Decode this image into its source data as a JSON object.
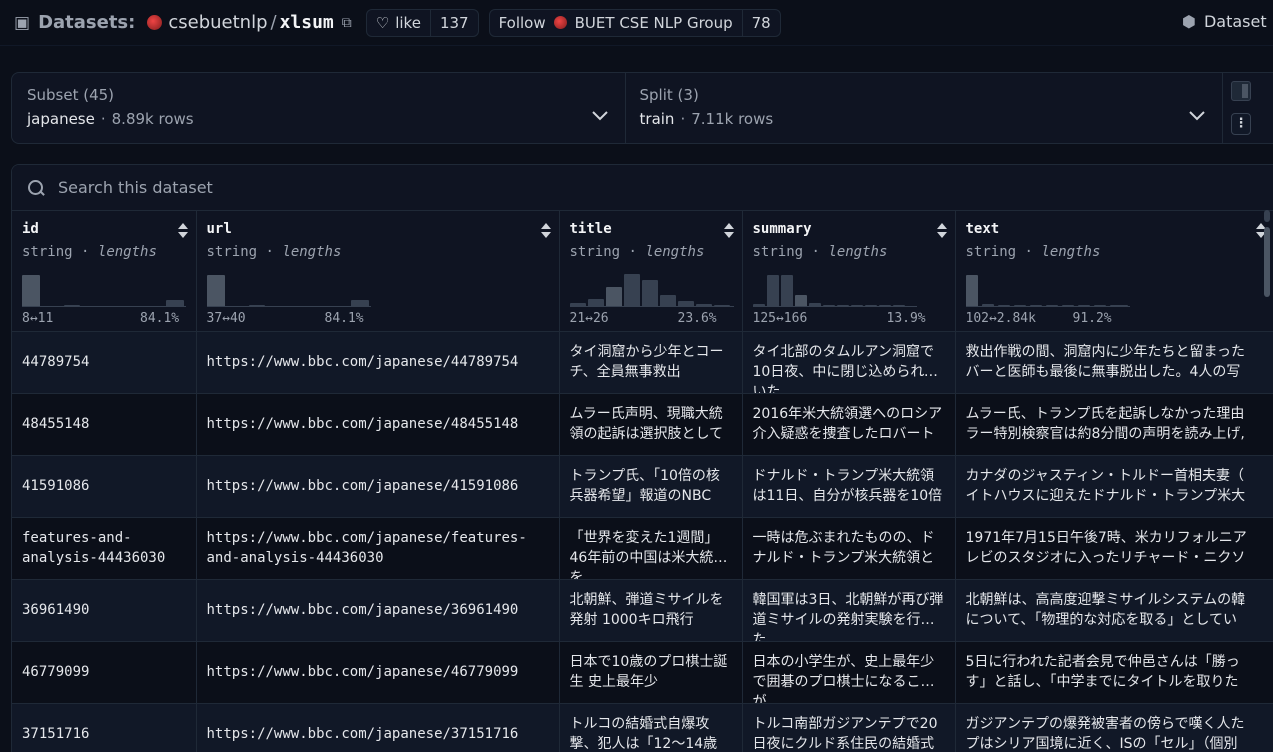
{
  "header": {
    "datasets_label": "Datasets:",
    "org": "csebuetnlp",
    "separator": "/",
    "repo": "xlsum",
    "like_label": "like",
    "like_count": "137",
    "follow_label": "Follow",
    "follow_org": "BUET CSE NLP Group",
    "follow_count": "78",
    "tab_label": "Dataset"
  },
  "subset": {
    "title": "Subset (45)",
    "value": "japanese",
    "dot": "·",
    "rows": "8.89k rows"
  },
  "split": {
    "title": "Split (3)",
    "value": "train",
    "dot": "·",
    "rows": "7.11k rows"
  },
  "search": {
    "placeholder": "Search this dataset"
  },
  "columns": [
    {
      "name": "id",
      "type": "string",
      "sep": "·",
      "stat": "lengths",
      "range": "8↔11",
      "pct": "84.1%"
    },
    {
      "name": "url",
      "type": "string",
      "sep": "·",
      "stat": "lengths",
      "range": "37↔40",
      "pct": "84.1%"
    },
    {
      "name": "title",
      "type": "string",
      "sep": "·",
      "stat": "lengths",
      "range": "21↔26",
      "pct": "23.6%"
    },
    {
      "name": "summary",
      "type": "string",
      "sep": "·",
      "stat": "lengths",
      "range": "125↔166",
      "pct": "13.9%"
    },
    {
      "name": "text",
      "type": "string",
      "sep": "·",
      "stat": "lengths",
      "range": "102↔2.84k",
      "pct": "91.2%"
    }
  ],
  "rows": [
    {
      "id": "44789754",
      "url": "https://www.bbc.com/japanese/44789754",
      "title": "タイ洞窟から少年とコーチ、全員無事救出",
      "summary": "タイ北部のタムルアン洞窟で10日夜、中に閉じ込められていた",
      "text1": "救出作戦の間、洞窟内に少年たちと留まった",
      "text2": "バーと医師も最後に無事脱出した。4人の写"
    },
    {
      "id": "48455148",
      "url": "https://www.bbc.com/japanese/48455148",
      "title": "ムラー氏声明、現職大統領の起訴は選択肢として",
      "summary": "2016年米大統領選へのロシア介入疑惑を捜査したロバート",
      "text1": "ムラー氏、トランプ氏を起訴しなかった理由",
      "text2": "ラー特別検察官は約8分間の声明を読み上げ,"
    },
    {
      "id": "41591086",
      "url": "https://www.bbc.com/japanese/41591086",
      "title": "トランプ氏、「10倍の核兵器希望」報道のNBC",
      "summary": "ドナルド・トランプ米大統領は11日、自分が核兵器を10倍",
      "text1": "カナダのジャスティン・トルドー首相夫妻（",
      "text2": "イトハウスに迎えたドナルド・トランプ米大"
    },
    {
      "id1": "features-and-",
      "id2": "analysis-44436030",
      "url1": "https://www.bbc.com/japanese/features-",
      "url2": "and-analysis-44436030",
      "title": "「世界を変えた1週間」46年前の中国は米大統領を",
      "summary": "一時は危ぶまれたものの、ドナルド・トランプ米大統領と",
      "text1": "1971年7月15日午後7時、米カリフォルニア",
      "text2": "レビのスタジオに入ったリチャード・ニクソ"
    },
    {
      "id": "36961490",
      "url": "https://www.bbc.com/japanese/36961490",
      "title": "北朝鮮、弾道ミサイルを発射 1000キロ飛行",
      "summary": "韓国軍は3日、北朝鮮が再び弾道ミサイルの発射実験を行った",
      "text1": "北朝鮮は、高高度迎撃ミサイルシステムの韓",
      "text2": "について、「物理的な対応を取る」としてい"
    },
    {
      "id": "46779099",
      "url": "https://www.bbc.com/japanese/46779099",
      "title": "日本で10歳のプロ棋士誕生 史上最年少",
      "summary": "日本の小学生が、史上最年少で囲碁のプロ棋士になることが",
      "text1": "5日に行われた記者会見で仲邑さんは「勝っ",
      "text2": "す」と話し、「中学までにタイトルを取りた"
    },
    {
      "id": "37151716",
      "url": "https://www.bbc.com/japanese/37151716",
      "title": "トルコの結婚式自爆攻撃、犯人は「12～14歳",
      "summary": "トルコ南部ガジアンテプで20日夜にクルド系住民の結婚式",
      "text1": "ガジアンテプの爆発被害者の傍らで嘆く人た",
      "text2": "プはシリア国境に近く、ISの「セル」（個別"
    }
  ]
}
